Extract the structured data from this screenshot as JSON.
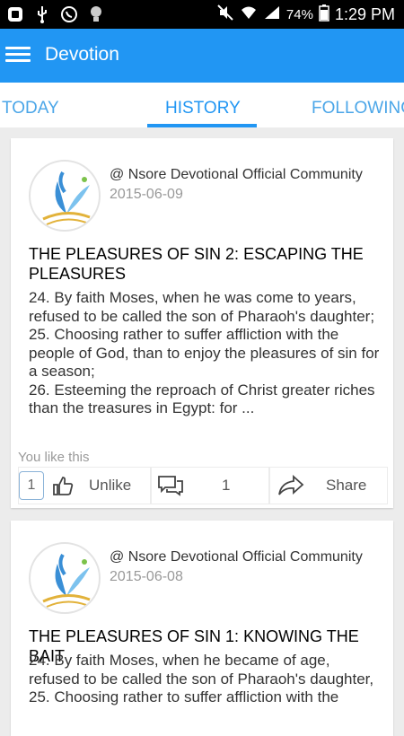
{
  "status_bar": {
    "battery": "74%",
    "time": "1:29 PM"
  },
  "app_bar": {
    "title": "Devotion"
  },
  "tabs": [
    {
      "label": "TODAY"
    },
    {
      "label": "HISTORY"
    },
    {
      "label": "FOLLOWING"
    }
  ],
  "posts": [
    {
      "author": "@ Nsore Devotional Official Community",
      "date": "2015-06-09",
      "title": "THE PLEASURES OF SIN 2: ESCAPING THE PLEASURES",
      "body": "24.  By faith Moses, when he was come to years, refused to be called the son of Pharaoh's daughter;\n25. Choosing rather to suffer affliction with the people of God, than to enjoy the pleasures of sin for a season;\n26. Esteeming the reproach of Christ greater riches than the treasures in Egypt: for  ...",
      "likes_text": "You like this",
      "like_count": "1",
      "unlike_label": "Unlike",
      "comment_count": "1",
      "share_label": "Share"
    },
    {
      "author": "@ Nsore Devotional Official Community",
      "date": "2015-06-08",
      "title": "THE PLEASURES OF SIN 1: KNOWING THE BAIT",
      "body": "24. By faith Moses, when he became of age, refused to be called the son of Pharaoh's daughter,\n25. Choosing rather to suffer affliction with the"
    }
  ],
  "colors": {
    "accent": "#2196f3",
    "tab_inactive": "#4ba6e8",
    "status_bar": "#000000"
  }
}
